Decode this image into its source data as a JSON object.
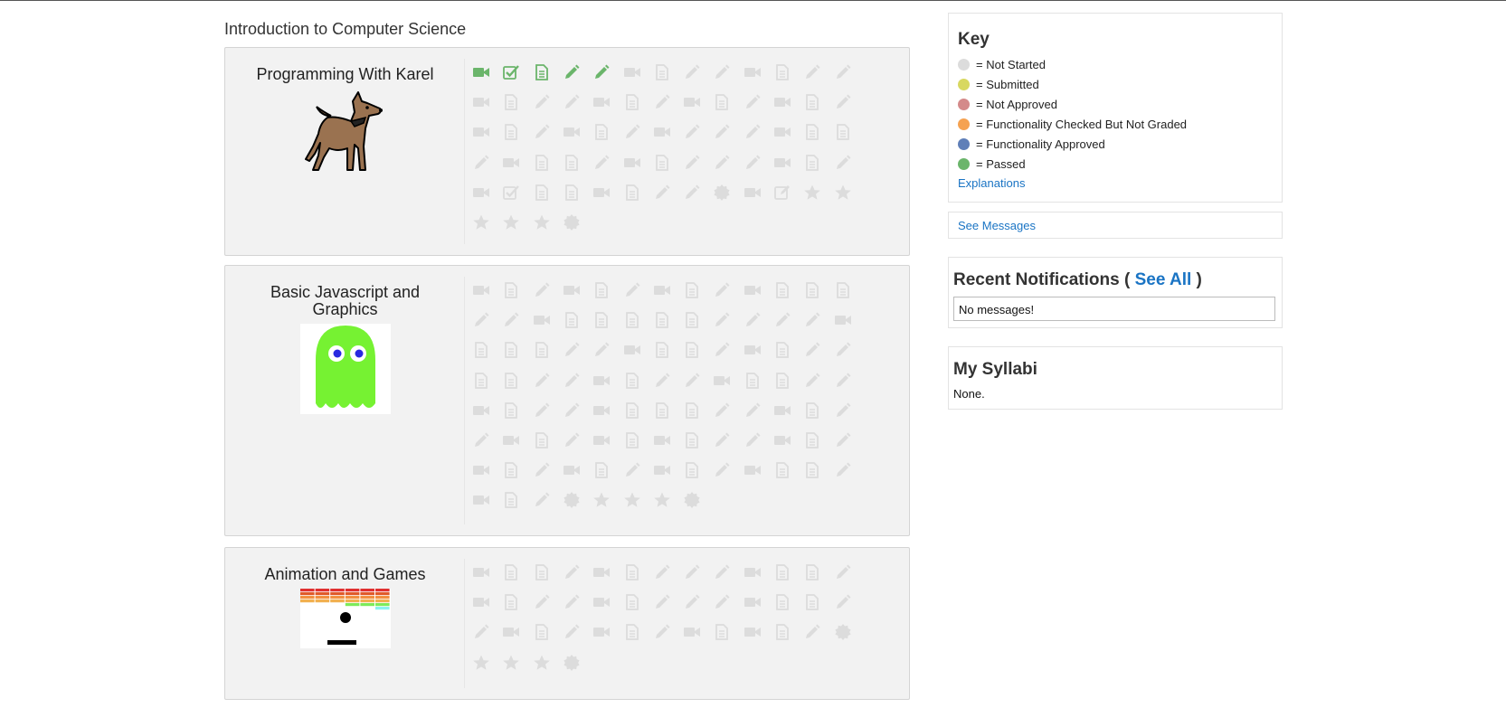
{
  "course": {
    "title": "Introduction to Computer Science"
  },
  "colors": {
    "not_started": "#dcdcdc",
    "submitted": "#d8d860",
    "not_approved": "#d48a8a",
    "checked": "#f5a251",
    "approved": "#5f7fb8",
    "passed": "#6bb56b",
    "link": "#1a74c4"
  },
  "modules": [
    {
      "name": "Programming With Karel",
      "image": "karel-dog",
      "items": [
        {
          "icon": "video",
          "status": "passed"
        },
        {
          "icon": "check",
          "status": "passed"
        },
        {
          "icon": "doc",
          "status": "passed"
        },
        {
          "icon": "pencil",
          "status": "passed"
        },
        {
          "icon": "pencil",
          "status": "passed"
        },
        {
          "icon": "video",
          "status": "not_started"
        },
        {
          "icon": "doc",
          "status": "not_started"
        },
        {
          "icon": "pencil",
          "status": "not_started"
        },
        {
          "icon": "pencil",
          "status": "not_started"
        },
        {
          "icon": "video",
          "status": "not_started"
        },
        {
          "icon": "doc",
          "status": "not_started"
        },
        {
          "icon": "pencil",
          "status": "not_started"
        },
        {
          "icon": "pencil",
          "status": "not_started"
        },
        {
          "icon": "video",
          "status": "not_started"
        },
        {
          "icon": "doc",
          "status": "not_started"
        },
        {
          "icon": "pencil",
          "status": "not_started"
        },
        {
          "icon": "pencil",
          "status": "not_started"
        },
        {
          "icon": "video",
          "status": "not_started"
        },
        {
          "icon": "doc",
          "status": "not_started"
        },
        {
          "icon": "pencil",
          "status": "not_started"
        },
        {
          "icon": "video",
          "status": "not_started"
        },
        {
          "icon": "doc",
          "status": "not_started"
        },
        {
          "icon": "pencil",
          "status": "not_started"
        },
        {
          "icon": "video",
          "status": "not_started"
        },
        {
          "icon": "doc",
          "status": "not_started"
        },
        {
          "icon": "pencil",
          "status": "not_started"
        },
        {
          "icon": "video",
          "status": "not_started"
        },
        {
          "icon": "doc",
          "status": "not_started"
        },
        {
          "icon": "pencil",
          "status": "not_started"
        },
        {
          "icon": "video",
          "status": "not_started"
        },
        {
          "icon": "doc",
          "status": "not_started"
        },
        {
          "icon": "pencil",
          "status": "not_started"
        },
        {
          "icon": "video",
          "status": "not_started"
        },
        {
          "icon": "pencil",
          "status": "not_started"
        },
        {
          "icon": "pencil",
          "status": "not_started"
        },
        {
          "icon": "pencil",
          "status": "not_started"
        },
        {
          "icon": "video",
          "status": "not_started"
        },
        {
          "icon": "doc",
          "status": "not_started"
        },
        {
          "icon": "doc",
          "status": "not_started"
        },
        {
          "icon": "pencil",
          "status": "not_started"
        },
        {
          "icon": "video",
          "status": "not_started"
        },
        {
          "icon": "doc",
          "status": "not_started"
        },
        {
          "icon": "doc",
          "status": "not_started"
        },
        {
          "icon": "pencil",
          "status": "not_started"
        },
        {
          "icon": "video",
          "status": "not_started"
        },
        {
          "icon": "doc",
          "status": "not_started"
        },
        {
          "icon": "pencil",
          "status": "not_started"
        },
        {
          "icon": "pencil",
          "status": "not_started"
        },
        {
          "icon": "pencil",
          "status": "not_started"
        },
        {
          "icon": "video",
          "status": "not_started"
        },
        {
          "icon": "doc",
          "status": "not_started"
        },
        {
          "icon": "pencil",
          "status": "not_started"
        },
        {
          "icon": "video",
          "status": "not_started"
        },
        {
          "icon": "check",
          "status": "not_started"
        },
        {
          "icon": "doc",
          "status": "not_started"
        },
        {
          "icon": "doc",
          "status": "not_started"
        },
        {
          "icon": "video",
          "status": "not_started"
        },
        {
          "icon": "doc",
          "status": "not_started"
        },
        {
          "icon": "pencil",
          "status": "not_started"
        },
        {
          "icon": "pencil",
          "status": "not_started"
        },
        {
          "icon": "badge",
          "status": "not_started"
        },
        {
          "icon": "video",
          "status": "not_started"
        },
        {
          "icon": "edit",
          "status": "not_started"
        },
        {
          "icon": "star",
          "status": "not_started"
        },
        {
          "icon": "star",
          "status": "not_started"
        },
        {
          "icon": "star",
          "status": "not_started"
        },
        {
          "icon": "star",
          "status": "not_started"
        },
        {
          "icon": "star",
          "status": "not_started"
        },
        {
          "icon": "badge",
          "status": "not_started"
        }
      ]
    },
    {
      "name": "Basic Javascript and Graphics",
      "image": "green-ghost",
      "items": [
        {
          "icon": "video",
          "status": "not_started"
        },
        {
          "icon": "doc",
          "status": "not_started"
        },
        {
          "icon": "pencil",
          "status": "not_started"
        },
        {
          "icon": "video",
          "status": "not_started"
        },
        {
          "icon": "doc",
          "status": "not_started"
        },
        {
          "icon": "pencil",
          "status": "not_started"
        },
        {
          "icon": "video",
          "status": "not_started"
        },
        {
          "icon": "doc",
          "status": "not_started"
        },
        {
          "icon": "pencil",
          "status": "not_started"
        },
        {
          "icon": "video",
          "status": "not_started"
        },
        {
          "icon": "doc",
          "status": "not_started"
        },
        {
          "icon": "doc",
          "status": "not_started"
        },
        {
          "icon": "doc",
          "status": "not_started"
        },
        {
          "icon": "pencil",
          "status": "not_started"
        },
        {
          "icon": "pencil",
          "status": "not_started"
        },
        {
          "icon": "video",
          "status": "not_started"
        },
        {
          "icon": "doc",
          "status": "not_started"
        },
        {
          "icon": "doc",
          "status": "not_started"
        },
        {
          "icon": "doc",
          "status": "not_started"
        },
        {
          "icon": "doc",
          "status": "not_started"
        },
        {
          "icon": "doc",
          "status": "not_started"
        },
        {
          "icon": "pencil",
          "status": "not_started"
        },
        {
          "icon": "pencil",
          "status": "not_started"
        },
        {
          "icon": "pencil",
          "status": "not_started"
        },
        {
          "icon": "pencil",
          "status": "not_started"
        },
        {
          "icon": "video",
          "status": "not_started"
        },
        {
          "icon": "doc",
          "status": "not_started"
        },
        {
          "icon": "doc",
          "status": "not_started"
        },
        {
          "icon": "doc",
          "status": "not_started"
        },
        {
          "icon": "pencil",
          "status": "not_started"
        },
        {
          "icon": "pencil",
          "status": "not_started"
        },
        {
          "icon": "video",
          "status": "not_started"
        },
        {
          "icon": "doc",
          "status": "not_started"
        },
        {
          "icon": "doc",
          "status": "not_started"
        },
        {
          "icon": "pencil",
          "status": "not_started"
        },
        {
          "icon": "video",
          "status": "not_started"
        },
        {
          "icon": "doc",
          "status": "not_started"
        },
        {
          "icon": "pencil",
          "status": "not_started"
        },
        {
          "icon": "pencil",
          "status": "not_started"
        },
        {
          "icon": "doc",
          "status": "not_started"
        },
        {
          "icon": "doc",
          "status": "not_started"
        },
        {
          "icon": "pencil",
          "status": "not_started"
        },
        {
          "icon": "pencil",
          "status": "not_started"
        },
        {
          "icon": "video",
          "status": "not_started"
        },
        {
          "icon": "doc",
          "status": "not_started"
        },
        {
          "icon": "pencil",
          "status": "not_started"
        },
        {
          "icon": "pencil",
          "status": "not_started"
        },
        {
          "icon": "video",
          "status": "not_started"
        },
        {
          "icon": "doc",
          "status": "not_started"
        },
        {
          "icon": "doc",
          "status": "not_started"
        },
        {
          "icon": "pencil",
          "status": "not_started"
        },
        {
          "icon": "pencil",
          "status": "not_started"
        },
        {
          "icon": "video",
          "status": "not_started"
        },
        {
          "icon": "doc",
          "status": "not_started"
        },
        {
          "icon": "pencil",
          "status": "not_started"
        },
        {
          "icon": "pencil",
          "status": "not_started"
        },
        {
          "icon": "video",
          "status": "not_started"
        },
        {
          "icon": "doc",
          "status": "not_started"
        },
        {
          "icon": "doc",
          "status": "not_started"
        },
        {
          "icon": "doc",
          "status": "not_started"
        },
        {
          "icon": "pencil",
          "status": "not_started"
        },
        {
          "icon": "pencil",
          "status": "not_started"
        },
        {
          "icon": "video",
          "status": "not_started"
        },
        {
          "icon": "doc",
          "status": "not_started"
        },
        {
          "icon": "pencil",
          "status": "not_started"
        },
        {
          "icon": "pencil",
          "status": "not_started"
        },
        {
          "icon": "video",
          "status": "not_started"
        },
        {
          "icon": "doc",
          "status": "not_started"
        },
        {
          "icon": "pencil",
          "status": "not_started"
        },
        {
          "icon": "video",
          "status": "not_started"
        },
        {
          "icon": "doc",
          "status": "not_started"
        },
        {
          "icon": "video",
          "status": "not_started"
        },
        {
          "icon": "doc",
          "status": "not_started"
        },
        {
          "icon": "pencil",
          "status": "not_started"
        },
        {
          "icon": "pencil",
          "status": "not_started"
        },
        {
          "icon": "video",
          "status": "not_started"
        },
        {
          "icon": "doc",
          "status": "not_started"
        },
        {
          "icon": "pencil",
          "status": "not_started"
        },
        {
          "icon": "video",
          "status": "not_started"
        },
        {
          "icon": "doc",
          "status": "not_started"
        },
        {
          "icon": "pencil",
          "status": "not_started"
        },
        {
          "icon": "video",
          "status": "not_started"
        },
        {
          "icon": "doc",
          "status": "not_started"
        },
        {
          "icon": "pencil",
          "status": "not_started"
        },
        {
          "icon": "video",
          "status": "not_started"
        },
        {
          "icon": "doc",
          "status": "not_started"
        },
        {
          "icon": "pencil",
          "status": "not_started"
        },
        {
          "icon": "video",
          "status": "not_started"
        },
        {
          "icon": "doc",
          "status": "not_started"
        },
        {
          "icon": "doc",
          "status": "not_started"
        },
        {
          "icon": "pencil",
          "status": "not_started"
        },
        {
          "icon": "video",
          "status": "not_started"
        },
        {
          "icon": "doc",
          "status": "not_started"
        },
        {
          "icon": "pencil",
          "status": "not_started"
        },
        {
          "icon": "badge",
          "status": "not_started"
        },
        {
          "icon": "star",
          "status": "not_started"
        },
        {
          "icon": "star",
          "status": "not_started"
        },
        {
          "icon": "star",
          "status": "not_started"
        },
        {
          "icon": "badge",
          "status": "not_started"
        }
      ]
    },
    {
      "name": "Animation and Games",
      "image": "breakout-game",
      "items": [
        {
          "icon": "video",
          "status": "not_started"
        },
        {
          "icon": "doc",
          "status": "not_started"
        },
        {
          "icon": "doc",
          "status": "not_started"
        },
        {
          "icon": "pencil",
          "status": "not_started"
        },
        {
          "icon": "video",
          "status": "not_started"
        },
        {
          "icon": "doc",
          "status": "not_started"
        },
        {
          "icon": "pencil",
          "status": "not_started"
        },
        {
          "icon": "pencil",
          "status": "not_started"
        },
        {
          "icon": "pencil",
          "status": "not_started"
        },
        {
          "icon": "video",
          "status": "not_started"
        },
        {
          "icon": "doc",
          "status": "not_started"
        },
        {
          "icon": "doc",
          "status": "not_started"
        },
        {
          "icon": "pencil",
          "status": "not_started"
        },
        {
          "icon": "video",
          "status": "not_started"
        },
        {
          "icon": "doc",
          "status": "not_started"
        },
        {
          "icon": "pencil",
          "status": "not_started"
        },
        {
          "icon": "pencil",
          "status": "not_started"
        },
        {
          "icon": "video",
          "status": "not_started"
        },
        {
          "icon": "doc",
          "status": "not_started"
        },
        {
          "icon": "pencil",
          "status": "not_started"
        },
        {
          "icon": "pencil",
          "status": "not_started"
        },
        {
          "icon": "pencil",
          "status": "not_started"
        },
        {
          "icon": "video",
          "status": "not_started"
        },
        {
          "icon": "doc",
          "status": "not_started"
        },
        {
          "icon": "doc",
          "status": "not_started"
        },
        {
          "icon": "pencil",
          "status": "not_started"
        },
        {
          "icon": "pencil",
          "status": "not_started"
        },
        {
          "icon": "video",
          "status": "not_started"
        },
        {
          "icon": "doc",
          "status": "not_started"
        },
        {
          "icon": "pencil",
          "status": "not_started"
        },
        {
          "icon": "video",
          "status": "not_started"
        },
        {
          "icon": "doc",
          "status": "not_started"
        },
        {
          "icon": "pencil",
          "status": "not_started"
        },
        {
          "icon": "video",
          "status": "not_started"
        },
        {
          "icon": "doc",
          "status": "not_started"
        },
        {
          "icon": "video",
          "status": "not_started"
        },
        {
          "icon": "doc",
          "status": "not_started"
        },
        {
          "icon": "pencil",
          "status": "not_started"
        },
        {
          "icon": "badge",
          "status": "not_started"
        },
        {
          "icon": "star",
          "status": "not_started"
        },
        {
          "icon": "star",
          "status": "not_started"
        },
        {
          "icon": "star",
          "status": "not_started"
        },
        {
          "icon": "badge",
          "status": "not_started"
        }
      ]
    }
  ],
  "key": {
    "title": "Key",
    "entries": [
      {
        "label": "= Not Started",
        "status": "not_started"
      },
      {
        "label": "= Submitted",
        "status": "submitted"
      },
      {
        "label": "= Not Approved",
        "status": "not_approved"
      },
      {
        "label": "= Functionality Checked But Not Graded",
        "status": "checked"
      },
      {
        "label": "= Functionality Approved",
        "status": "approved"
      },
      {
        "label": "= Passed",
        "status": "passed"
      }
    ],
    "explanations": "Explanations"
  },
  "messages": {
    "link": "See Messages"
  },
  "notifications": {
    "title": "Recent Notifications",
    "open": "(",
    "see_all": "See All",
    "close": ")",
    "empty": "No messages!"
  },
  "syllabi": {
    "title": "My Syllabi",
    "empty": "None."
  }
}
